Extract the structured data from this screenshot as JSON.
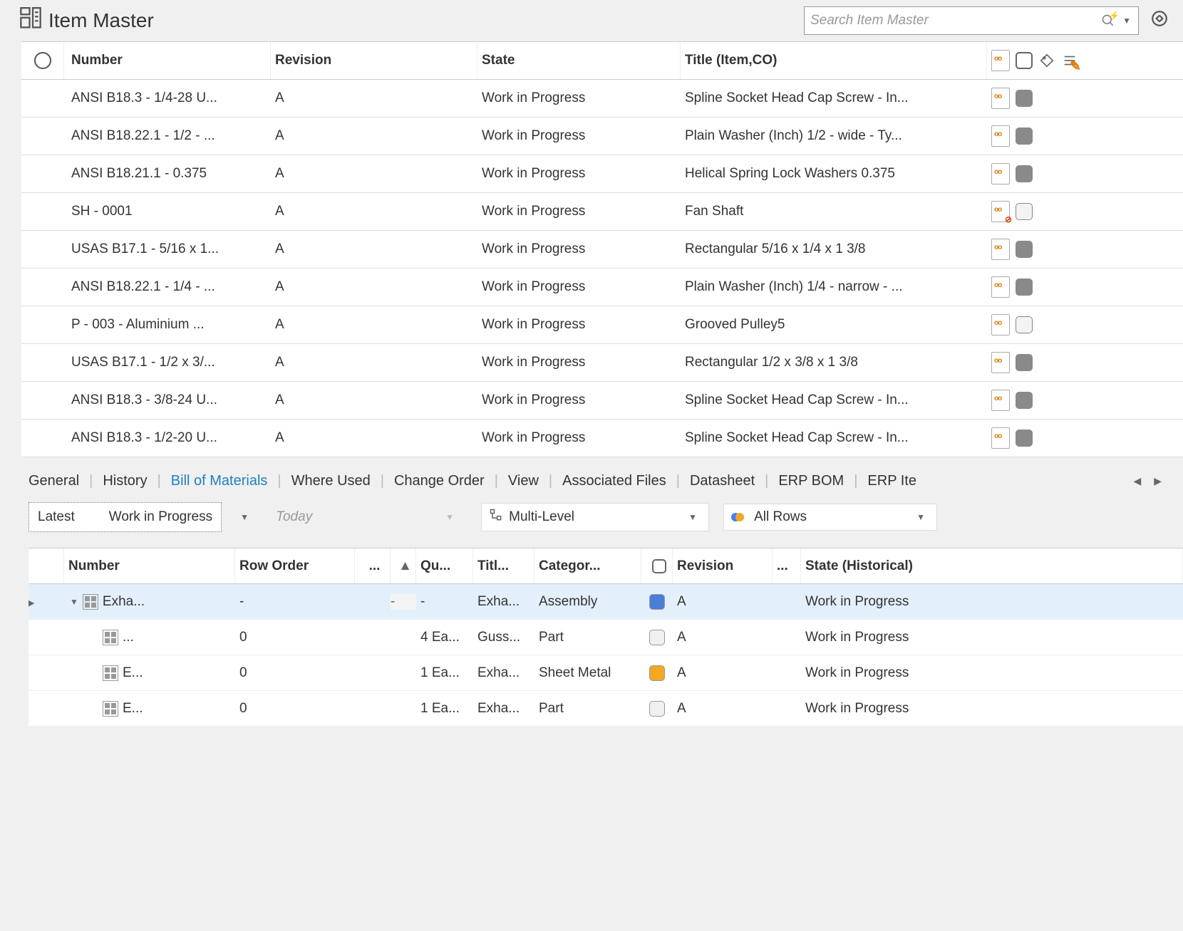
{
  "header": {
    "title": "Item Master",
    "search_placeholder": "Search Item Master"
  },
  "grid": {
    "columns": {
      "number": "Number",
      "revision": "Revision",
      "state": "State",
      "title_itemco": "Title (Item,CO)"
    },
    "rows": [
      {
        "number": "ANSI B18.3 - 1/4-28 U...",
        "revision": "A",
        "state": "Work in Progress",
        "title": "Spline Socket Head Cap Screw - In...",
        "badge": "normal",
        "chk": "dark"
      },
      {
        "number": "ANSI B18.22.1 - 1/2 - ...",
        "revision": "A",
        "state": "Work in Progress",
        "title": "Plain Washer (Inch) 1/2 - wide - Ty...",
        "badge": "normal",
        "chk": "dark"
      },
      {
        "number": "ANSI B18.21.1 - 0.375",
        "revision": "A",
        "state": "Work in Progress",
        "title": "Helical Spring Lock Washers 0.375",
        "badge": "normal",
        "chk": "dark"
      },
      {
        "number": "SH - 0001",
        "revision": "A",
        "state": "Work in Progress",
        "title": "Fan Shaft",
        "badge": "err",
        "chk": "light"
      },
      {
        "number": "USAS B17.1 - 5/16 x 1...",
        "revision": "A",
        "state": "Work in Progress",
        "title": "Rectangular 5/16 x 1/4 x 1 3/8",
        "badge": "normal",
        "chk": "dark"
      },
      {
        "number": "ANSI B18.22.1 - 1/4 - ...",
        "revision": "A",
        "state": "Work in Progress",
        "title": "Plain Washer (Inch) 1/4 - narrow - ...",
        "badge": "normal",
        "chk": "dark"
      },
      {
        "number": "P - 003 - Aluminium ...",
        "revision": "A",
        "state": "Work in Progress",
        "title": "Grooved Pulley5",
        "badge": "normal",
        "chk": "light"
      },
      {
        "number": "USAS B17.1 - 1/2 x 3/...",
        "revision": "A",
        "state": "Work in Progress",
        "title": "Rectangular 1/2 x 3/8 x 1 3/8",
        "badge": "normal",
        "chk": "dark"
      },
      {
        "number": "ANSI B18.3 - 3/8-24 U...",
        "revision": "A",
        "state": "Work in Progress",
        "title": "Spline Socket Head Cap Screw - In...",
        "badge": "normal",
        "chk": "dark"
      },
      {
        "number": "ANSI B18.3 - 1/2-20 U...",
        "revision": "A",
        "state": "Work in Progress",
        "title": "Spline Socket Head Cap Screw - In...",
        "badge": "normal",
        "chk": "dark"
      }
    ]
  },
  "tabs": [
    "General",
    "History",
    "Bill of Materials",
    "Where Used",
    "Change Order",
    "View",
    "Associated Files",
    "Datasheet",
    "ERP BOM",
    "ERP Ite"
  ],
  "active_tab": "Bill of Materials",
  "filters": {
    "latest": "Latest",
    "wip": "Work in Progress",
    "today": "Today",
    "level": "Multi-Level",
    "rows": "All Rows"
  },
  "bom": {
    "columns": {
      "number": "Number",
      "roworder": "Row Order",
      "dots": "...",
      "qty": "Qu...",
      "titl": "Titl...",
      "cat": "Categor...",
      "rev": "Revision",
      "dots2": "...",
      "state": "State (Historical)"
    },
    "rows": [
      {
        "indent": 0,
        "expanded": true,
        "num": "Exha...",
        "roworder": "-",
        "sort": "-",
        "qty": "-",
        "titl": "Exha...",
        "cat": "Assembly",
        "color": "blue",
        "rev": "A",
        "state": "Work in Progress",
        "selected": true
      },
      {
        "indent": 1,
        "num": "...",
        "roworder": "0",
        "qty": "4 Ea...",
        "titl": "Guss...",
        "cat": "Part",
        "color": "gray",
        "rev": "A",
        "state": "Work in Progress"
      },
      {
        "indent": 1,
        "num": "E...",
        "roworder": "0",
        "qty": "1 Ea...",
        "titl": "Exha...",
        "cat": "Sheet Metal",
        "color": "yellow",
        "rev": "A",
        "state": "Work in Progress"
      },
      {
        "indent": 1,
        "num": "E...",
        "roworder": "0",
        "qty": "1 Ea...",
        "titl": "Exha...",
        "cat": "Part",
        "color": "gray",
        "rev": "A",
        "state": "Work in Progress"
      }
    ]
  }
}
